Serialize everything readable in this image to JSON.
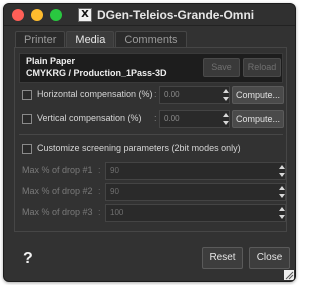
{
  "window": {
    "title": "DGen-Teleios-Grande-Omni",
    "app_icon": "x11-icon"
  },
  "tabs": [
    {
      "label": "Printer",
      "active": false
    },
    {
      "label": "Media",
      "active": true
    },
    {
      "label": "Comments",
      "active": false
    }
  ],
  "media": {
    "paper_name": "Plain Paper",
    "print_mode": "CMYKRG / Production_1Pass-3D",
    "save_label": "Save",
    "reload_label": "Reload"
  },
  "compensation": {
    "horizontal": {
      "label": "Horizontal compensation (%)",
      "value": "0.00",
      "checked": false,
      "compute_label": "Compute..."
    },
    "vertical": {
      "label": "Vertical compensation (%)",
      "value": "0.00",
      "checked": false,
      "compute_label": "Compute..."
    }
  },
  "screening": {
    "label": "Customize screening parameters (2bit modes only)",
    "checked": false,
    "drops": [
      {
        "label": "Max % of drop #1",
        "value": "90"
      },
      {
        "label": "Max % of drop #2",
        "value": "90"
      },
      {
        "label": "Max % of drop #3",
        "value": "100"
      }
    ]
  },
  "footer": {
    "help_label": "?",
    "reset_label": "Reset",
    "close_label": "Close"
  },
  "colors": {
    "window_bg": "#323232",
    "paper_box_bg": "#1d1d1d",
    "close_light": "#fe5f57",
    "min_light": "#febc2e",
    "max_light": "#29c840"
  }
}
